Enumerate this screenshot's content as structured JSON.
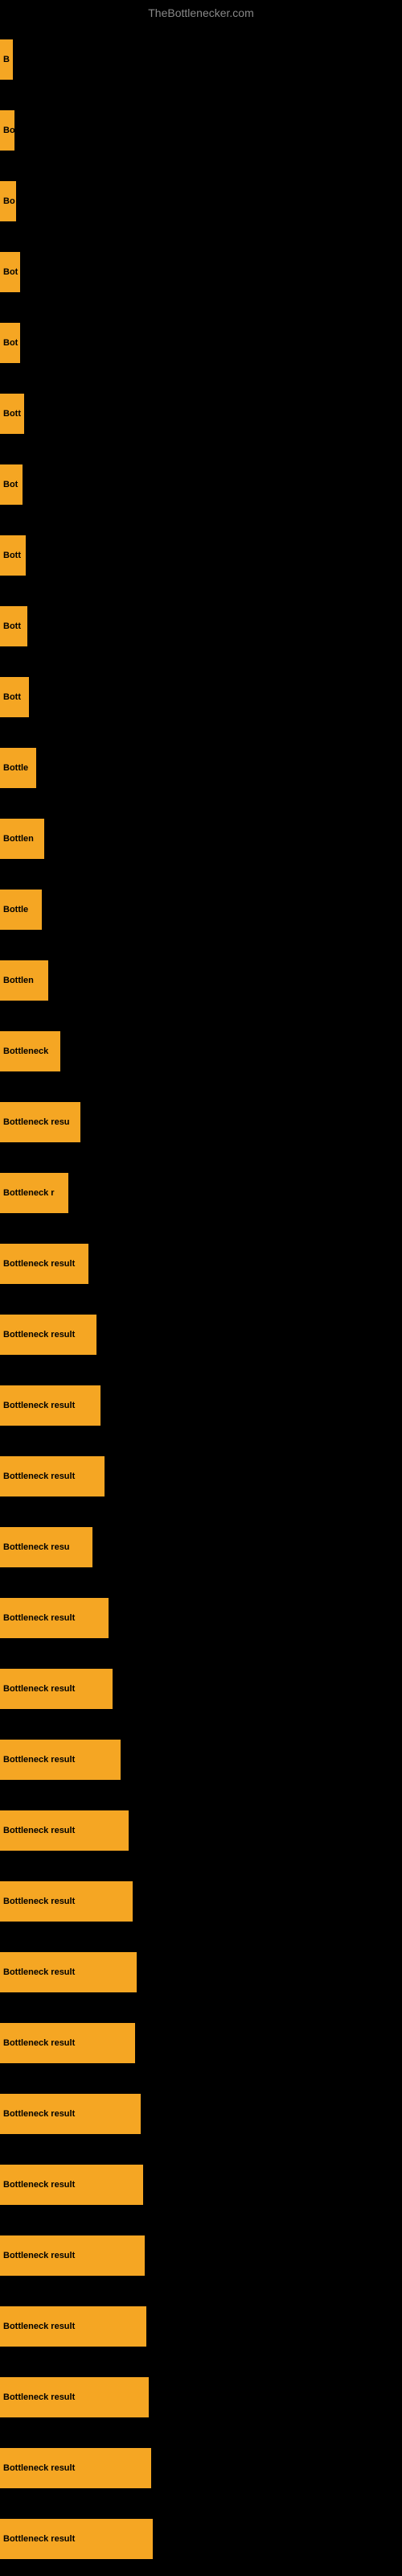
{
  "site": {
    "title": "TheBottlenecker.com"
  },
  "bars": [
    {
      "label": "B",
      "width": 16
    },
    {
      "label": "Bo",
      "width": 18
    },
    {
      "label": "Bo",
      "width": 20
    },
    {
      "label": "Bot",
      "width": 25
    },
    {
      "label": "Bot",
      "width": 25
    },
    {
      "label": "Bott",
      "width": 30
    },
    {
      "label": "Bot",
      "width": 28
    },
    {
      "label": "Bott",
      "width": 32
    },
    {
      "label": "Bott",
      "width": 34
    },
    {
      "label": "Bott",
      "width": 36
    },
    {
      "label": "Bottle",
      "width": 45
    },
    {
      "label": "Bottlen",
      "width": 55
    },
    {
      "label": "Bottle",
      "width": 52
    },
    {
      "label": "Bottlen",
      "width": 60
    },
    {
      "label": "Bottleneck",
      "width": 75
    },
    {
      "label": "Bottleneck resu",
      "width": 100
    },
    {
      "label": "Bottleneck r",
      "width": 85
    },
    {
      "label": "Bottleneck result",
      "width": 110
    },
    {
      "label": "Bottleneck result",
      "width": 120
    },
    {
      "label": "Bottleneck result",
      "width": 125
    },
    {
      "label": "Bottleneck result",
      "width": 130
    },
    {
      "label": "Bottleneck resu",
      "width": 115
    },
    {
      "label": "Bottleneck result",
      "width": 135
    },
    {
      "label": "Bottleneck result",
      "width": 140
    },
    {
      "label": "Bottleneck result",
      "width": 150
    },
    {
      "label": "Bottleneck result",
      "width": 160
    },
    {
      "label": "Bottleneck result",
      "width": 165
    },
    {
      "label": "Bottleneck result",
      "width": 170
    },
    {
      "label": "Bottleneck result",
      "width": 168
    },
    {
      "label": "Bottleneck result",
      "width": 175
    },
    {
      "label": "Bottleneck result",
      "width": 178
    },
    {
      "label": "Bottleneck result",
      "width": 180
    },
    {
      "label": "Bottleneck result",
      "width": 182
    },
    {
      "label": "Bottleneck result",
      "width": 185
    },
    {
      "label": "Bottleneck result",
      "width": 188
    },
    {
      "label": "Bottleneck result",
      "width": 190
    }
  ]
}
